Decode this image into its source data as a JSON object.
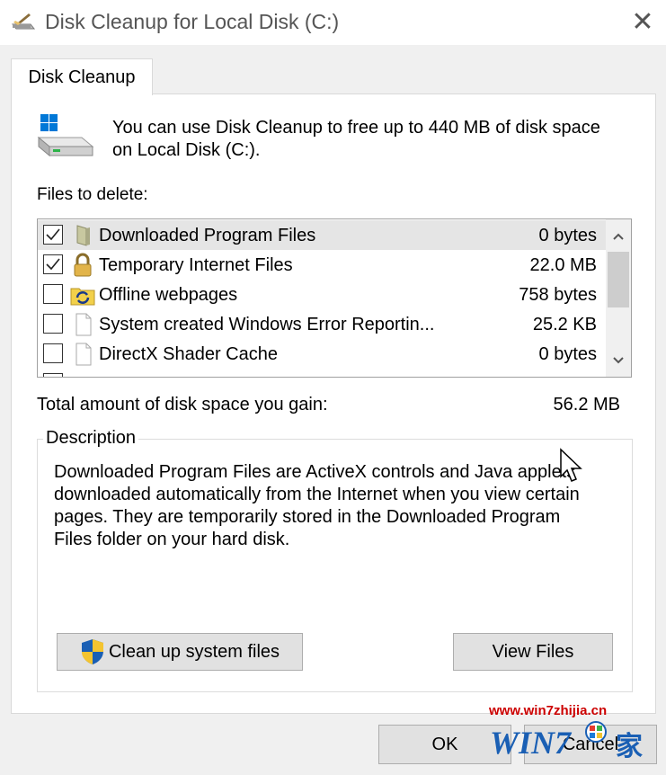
{
  "window": {
    "title": "Disk Cleanup for Local Disk (C:)",
    "close_glyph": "✕"
  },
  "tab": {
    "label": "Disk Cleanup"
  },
  "intro": {
    "text": "You can use Disk Cleanup to free up to 440 MB of disk space on Local Disk (C:)."
  },
  "files": {
    "label": "Files to delete:",
    "items": [
      {
        "name": "Downloaded Program Files",
        "size": "0 bytes",
        "checked": true,
        "selected": true,
        "icon": "folder-icon"
      },
      {
        "name": "Temporary Internet Files",
        "size": "22.0 MB",
        "checked": true,
        "selected": false,
        "icon": "lock-icon"
      },
      {
        "name": "Offline webpages",
        "size": "758 bytes",
        "checked": false,
        "selected": false,
        "icon": "sync-folder-icon"
      },
      {
        "name": "System created Windows Error Reportin...",
        "size": "25.2 KB",
        "checked": false,
        "selected": false,
        "icon": "file-icon"
      },
      {
        "name": "DirectX Shader Cache",
        "size": "0 bytes",
        "checked": false,
        "selected": false,
        "icon": "file-icon"
      }
    ]
  },
  "total": {
    "label": "Total amount of disk space you gain:",
    "value": "56.2 MB"
  },
  "description": {
    "legend": "Description",
    "text": "Downloaded Program Files are ActiveX controls and Java applets downloaded automatically from the Internet when you view certain pages. They are temporarily stored in the Downloaded Program Files folder on your hard disk."
  },
  "buttons": {
    "cleanup": "Clean up system files",
    "view": "View Files",
    "ok": "OK",
    "cancel": "Cancel"
  },
  "watermark": {
    "url": "www.win7zhijia.cn",
    "logo_text": "WIN7",
    "logo_char": "家"
  },
  "colors": {
    "accent": "#0078d7",
    "selected_row": "#e5e5e5",
    "watermark_red": "#cc0000",
    "watermark_blue": "#1a5fb4"
  }
}
